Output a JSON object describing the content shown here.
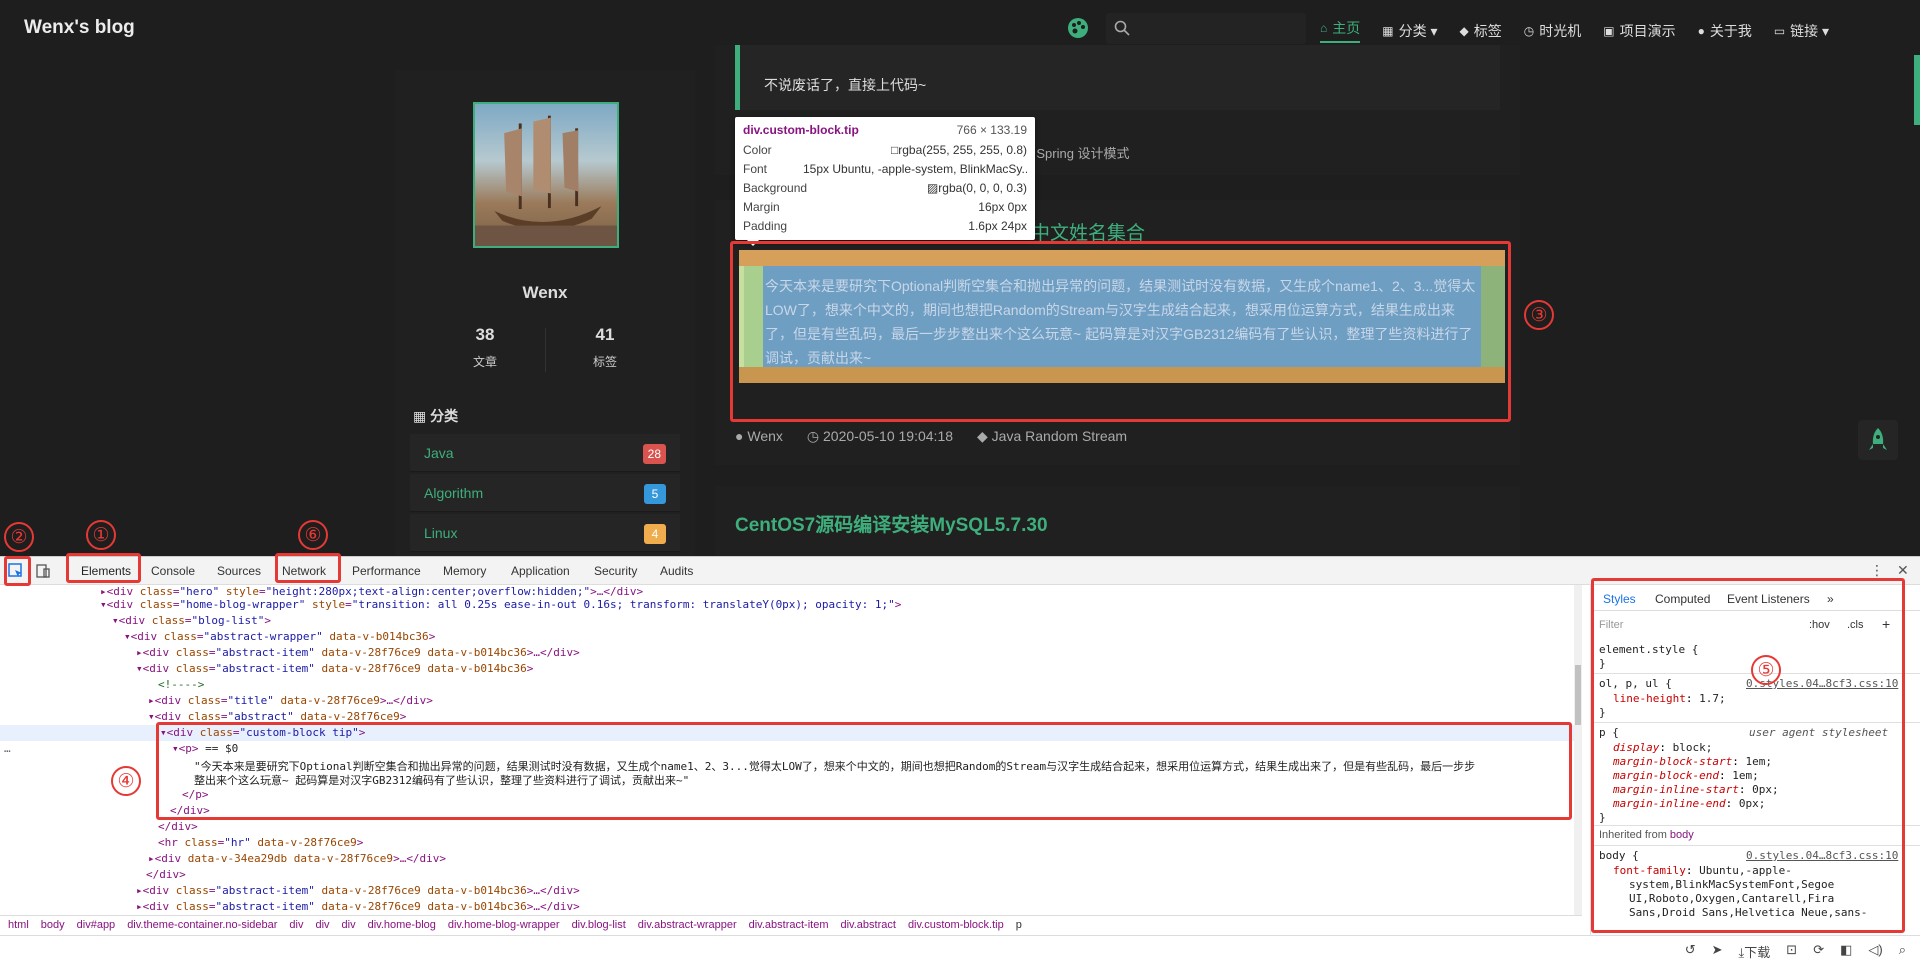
{
  "navbar": {
    "brand": "Wenx's blog",
    "items": [
      {
        "icon": "home-icon",
        "glyph": "⌂",
        "label": "主页",
        "active": true
      },
      {
        "icon": "grid-icon",
        "glyph": "▦",
        "label": "分类 ▾",
        "active": false
      },
      {
        "icon": "tag-icon",
        "glyph": "◆",
        "label": "标签",
        "active": false
      },
      {
        "icon": "clock-icon",
        "glyph": "◷",
        "label": "时光机",
        "active": false
      },
      {
        "icon": "video-icon",
        "glyph": "▣",
        "label": "项目演示",
        "active": false
      },
      {
        "icon": "user-icon",
        "glyph": "●",
        "label": "关于我",
        "active": false
      },
      {
        "icon": "link-icon",
        "glyph": "▭",
        "label": "链接 ▾",
        "active": false
      }
    ]
  },
  "profile": {
    "name": "Wenx",
    "articles_count": "38",
    "articles_label": "文章",
    "tags_count": "41",
    "tags_label": "标签",
    "category_title": "分类",
    "categories": [
      {
        "name": "Java",
        "count": "28",
        "color": "#d9534f"
      },
      {
        "name": "Algorithm",
        "count": "5",
        "color": "#3498db"
      },
      {
        "name": "Linux",
        "count": "4",
        "color": "#f0ad4e"
      }
    ]
  },
  "posts": {
    "first_tip": "不说废话了，直接上代码~",
    "first_tags": "va  Spring  设计模式",
    "second_title_fragment": "中文姓名集合",
    "second_abstract": "今天本来是要研究下Optional判断空集合和抛出异常的问题，结果测试时没有数据，又生成个name1、2、3...觉得太LOW了，想来个中文的，期间也想把Random的Stream与汉字生成结合起来，想采用位运算方式，结果生成出来了，但是有些乱码，最后一步步整出来个这么玩意~ 起码算是对汉字GB2312编码有了些认识，整理了些资料进行了调试，贡献出来~",
    "second_author": "Wenx",
    "second_date": "2020-05-10 19:04:18",
    "second_tags": "Java  Random  Stream",
    "third_title": "CentOS7源码编译安装MySQL5.7.30"
  },
  "tooltip": {
    "selector": "div.custom-block.tip",
    "size": "766 × 133.19",
    "rows": [
      {
        "k": "Color",
        "v": "□rgba(255, 255, 255, 0.8)"
      },
      {
        "k": "Font",
        "v": "15px Ubuntu, -apple-system, BlinkMacSy..."
      },
      {
        "k": "Background",
        "v": "▨rgba(0, 0, 0, 0.3)"
      },
      {
        "k": "Margin",
        "v": "16px 0px"
      },
      {
        "k": "Padding",
        "v": "1.6px 24px"
      }
    ]
  },
  "annotations": [
    "①",
    "②",
    "③",
    "④",
    "⑤",
    "⑥"
  ],
  "devtools": {
    "tabs": [
      "Elements",
      "Console",
      "Sources",
      "Network",
      "Performance",
      "Memory",
      "Application",
      "Security",
      "Audits"
    ],
    "styles_tabs": [
      "Styles",
      "Computed",
      "Event Listeners",
      "»"
    ],
    "filter_placeholder": "Filter",
    "hov": ":hov",
    "cls": ".cls",
    "breadcrumbs": [
      "html",
      "body",
      "div#app",
      "div.theme-container.no-sidebar",
      "div",
      "div",
      "div",
      "div.home-blog",
      "div.home-blog-wrapper",
      "div.blog-list",
      "div.abstract-wrapper",
      "div.abstract-item",
      "div.abstract",
      "div.custom-block.tip",
      "p"
    ],
    "bottom_download": "下载"
  }
}
